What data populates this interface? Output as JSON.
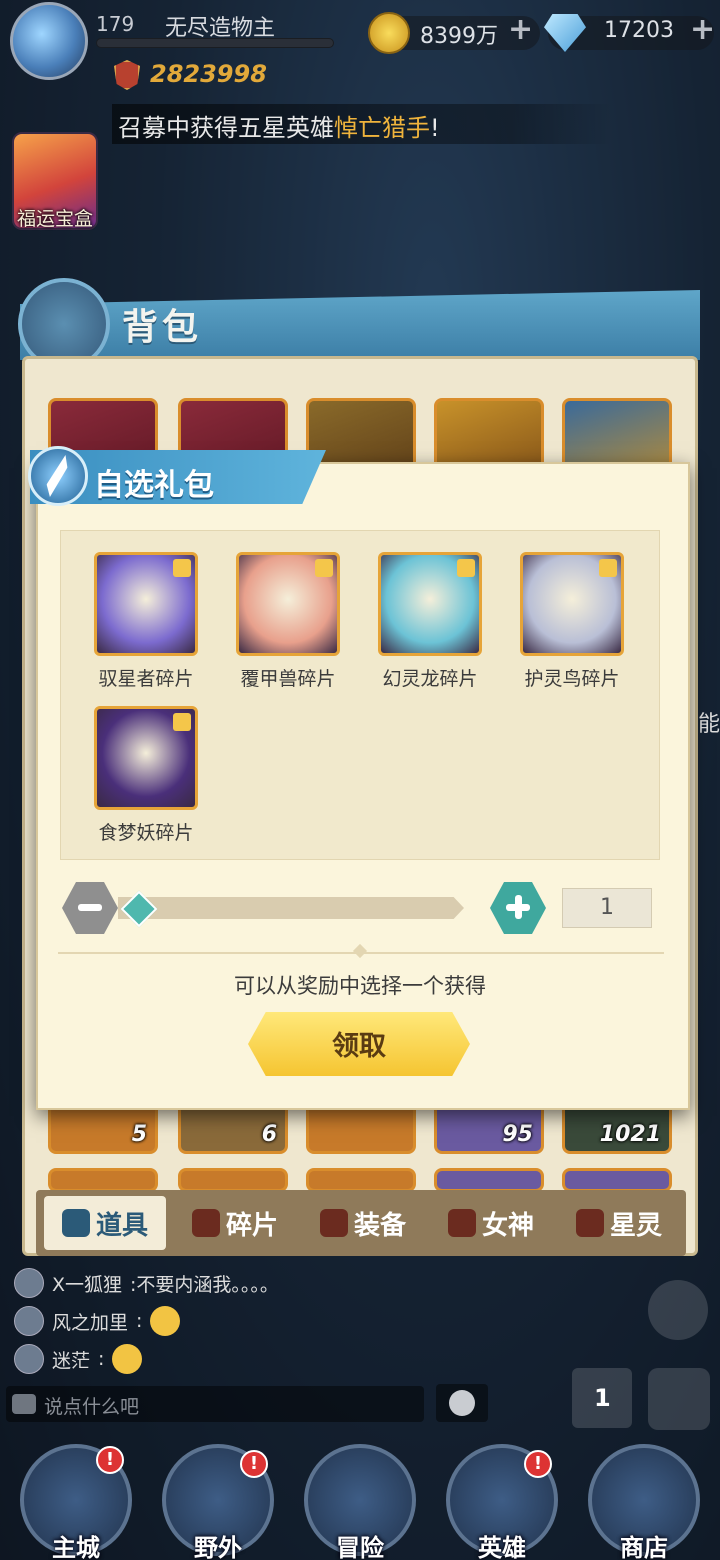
{
  "player": {
    "level": "179",
    "name": "无尽造物主",
    "power": "2823998"
  },
  "resources": {
    "gold": "8399万",
    "gems": "17203",
    "add_symbol": "+"
  },
  "ticker": {
    "text": "召募中获得五星英雄",
    "hero": "悼亡猎手",
    "suffix": "!"
  },
  "side": {
    "lucky_box_label": "福运宝盒",
    "edge_text": "能"
  },
  "backpack": {
    "title": "背包",
    "slot_counts": [
      "5",
      "6",
      "",
      "95",
      "1021"
    ],
    "tabs": [
      "道具",
      "碎片",
      "装备",
      "女神",
      "星灵"
    ]
  },
  "dialog": {
    "title": "自选礼包",
    "rewards": [
      {
        "name": "驭星者碎片",
        "color": "#7c6bcf"
      },
      {
        "name": "覆甲兽碎片",
        "color": "#e8a08c"
      },
      {
        "name": "幻灵龙碎片",
        "color": "#6cc3d6"
      },
      {
        "name": "护灵鸟碎片",
        "color": "#b9bfd6"
      },
      {
        "name": "食梦妖碎片",
        "color": "#4a2f7a"
      }
    ],
    "quantity": "1",
    "hint": "可以从奖励中选择一个获得",
    "claim_label": "领取"
  },
  "chat": {
    "messages": [
      {
        "user": "X一狐狸",
        "text": ":不要内涵我。。。。"
      },
      {
        "user": "风之加里",
        "text": ":"
      },
      {
        "user": "迷茫",
        "text": ":"
      }
    ],
    "placeholder": "说点什么吧",
    "rank_number": "1"
  },
  "nav": {
    "items": [
      "主城",
      "野外",
      "冒险",
      "英雄",
      "商店"
    ],
    "badge": "!"
  },
  "colors": {
    "accent_blue": "#3a8ec0",
    "gold_button": "#f5c531",
    "frame_orange": "#e6a438"
  }
}
